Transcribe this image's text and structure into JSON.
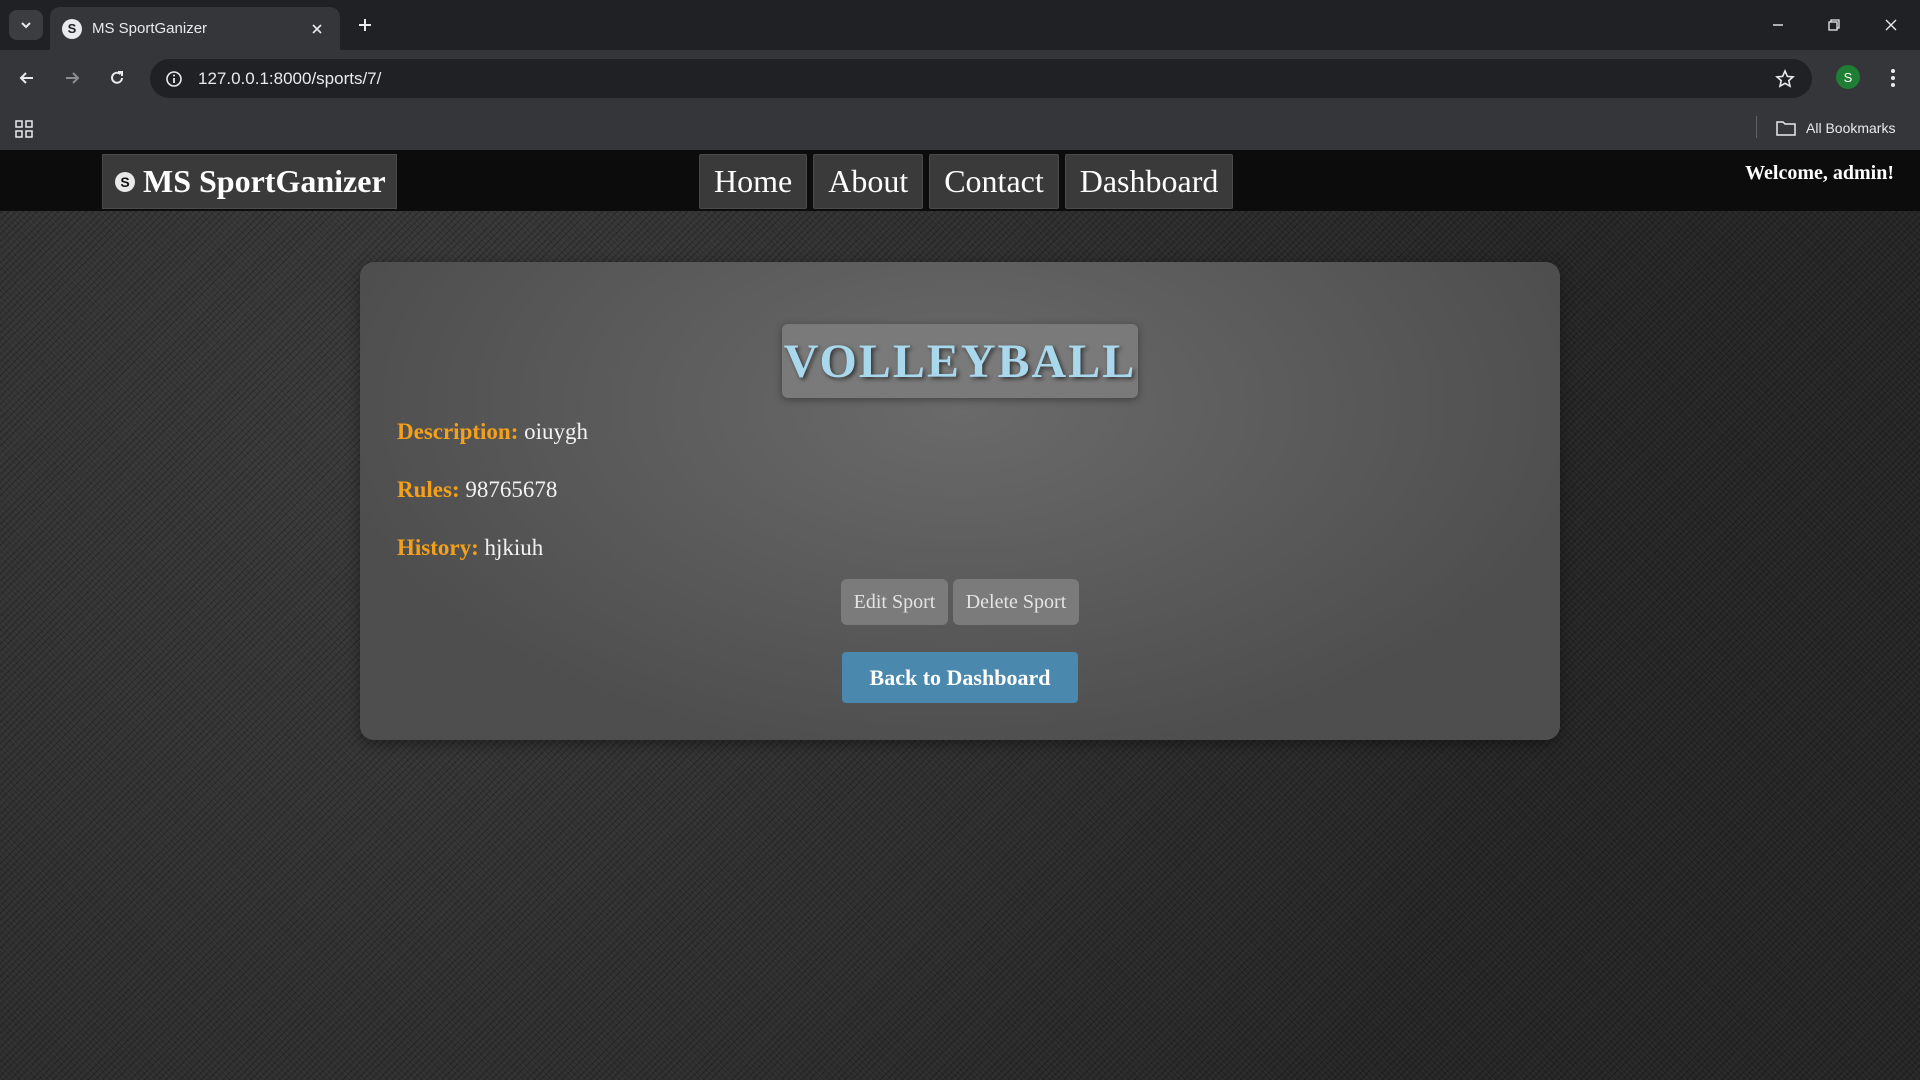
{
  "browser": {
    "tab_title": "MS SportGanizer",
    "tab_favicon": "S",
    "url": "127.0.0.1:8000/sports/7/",
    "profile_initial": "S",
    "bookmarks_label": "All Bookmarks"
  },
  "site": {
    "brand_logo": "S",
    "brand": "MS SportGanizer",
    "nav": [
      "Home",
      "About",
      "Contact",
      "Dashboard"
    ],
    "welcome": "Welcome, admin!"
  },
  "sport": {
    "name": "VOLLEYBALL",
    "description_label": "Description:",
    "description": "oiuygh",
    "rules_label": "Rules:",
    "rules": "98765678",
    "history_label": "History:",
    "history": "hjkiuh"
  },
  "actions": {
    "edit": "Edit Sport",
    "delete": "Delete Sport",
    "back": "Back to Dashboard"
  },
  "colors": {
    "label_accent": "#f5a01a",
    "title_text": "#a9d8ec",
    "primary_button": "#4a89ad"
  }
}
